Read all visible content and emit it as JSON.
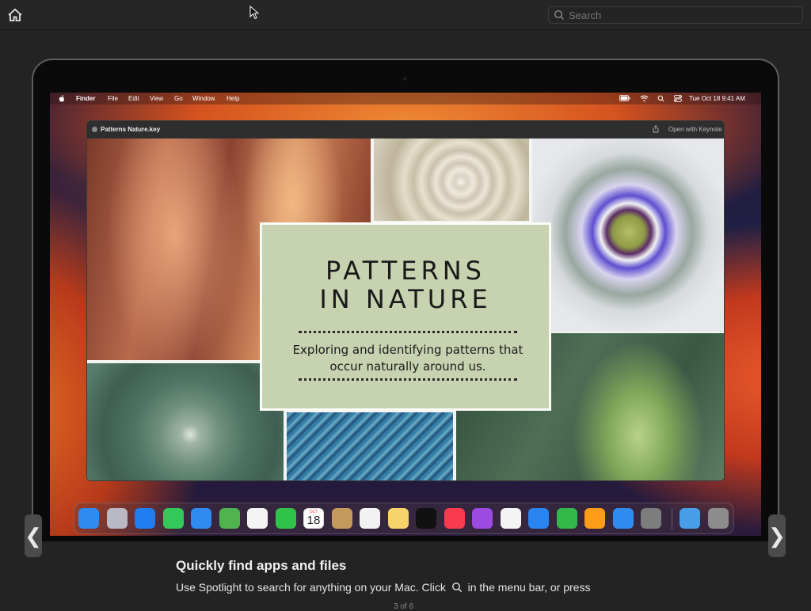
{
  "topbar": {
    "search_placeholder": "Search"
  },
  "menubar": {
    "app": "Finder",
    "items": [
      "File",
      "Edit",
      "View",
      "Go",
      "Window",
      "Help"
    ],
    "datetime": "Tue Oct 18  9:41 AM"
  },
  "keynote": {
    "window_title": "Patterns Nature.key",
    "open_with": "Open with Keynote",
    "slide_title_line1": "PATTERNS",
    "slide_title_line2": "IN NATURE",
    "slide_subtitle": "Exploring and identifying patterns that occur naturally around us."
  },
  "dock": {
    "calendar_month": "OCT",
    "calendar_day": "18",
    "colors": [
      "#2f8bf0",
      "#b9b9c4",
      "#1f7ef0",
      "#34c759",
      "#2f8bf0",
      "#4fb34f",
      "#f4f4f4",
      "#31c24b",
      "#ffffff",
      "#c49a5c",
      "#f2f2f2",
      "#f7d46a",
      "#111111",
      "#fa3b4f",
      "#9b4be0",
      "#f4f4f4",
      "#2a84ef",
      "#33b84a",
      "#ff9c1a",
      "#2f8bf0",
      "#7d7d7d"
    ]
  },
  "caption": {
    "title": "Quickly find apps and files",
    "text_before": "Use Spotlight to search for anything on your Mac. Click",
    "text_after": "in the menu bar, or press",
    "counter": "3 of 6"
  },
  "nav": {
    "prev": "❮",
    "next": "❯"
  }
}
